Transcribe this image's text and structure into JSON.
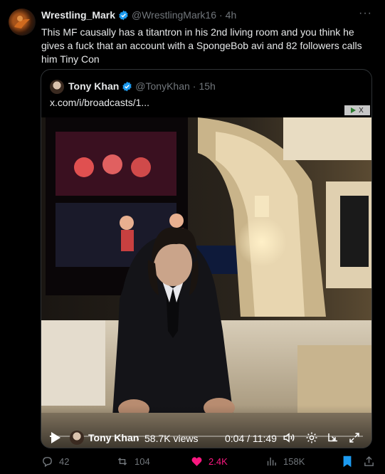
{
  "tweet": {
    "author_name": "Wrestling_Mark",
    "handle": "@WrestlingMark16",
    "separator": "·",
    "time": "4h",
    "more_label": "···",
    "text": "This MF causally has a titantron in his 2nd living room and you think he gives a fuck that an account with a SpongeBob avi and 82 followers calls him Tiny Con"
  },
  "quote": {
    "author_name": "Tony Khan",
    "handle": "@TonyKhan",
    "separator": "·",
    "time": "15h",
    "link_text": "x.com/i/broadcasts/1..."
  },
  "video": {
    "host_name": "Tony Khan",
    "views": "58.7K views",
    "time_display": "0:04 / 11:49",
    "progress_fraction": 0.006,
    "promo_label": "X"
  },
  "actions": {
    "replies": "42",
    "reposts": "104",
    "likes": "2.4K",
    "views": "158K"
  },
  "colors": {
    "background": "#000000",
    "text": "#e7e9ea",
    "muted": "#71767b",
    "verified": "#1d9bf0",
    "like": "#f91880",
    "bookmark": "#1d9bf0"
  }
}
